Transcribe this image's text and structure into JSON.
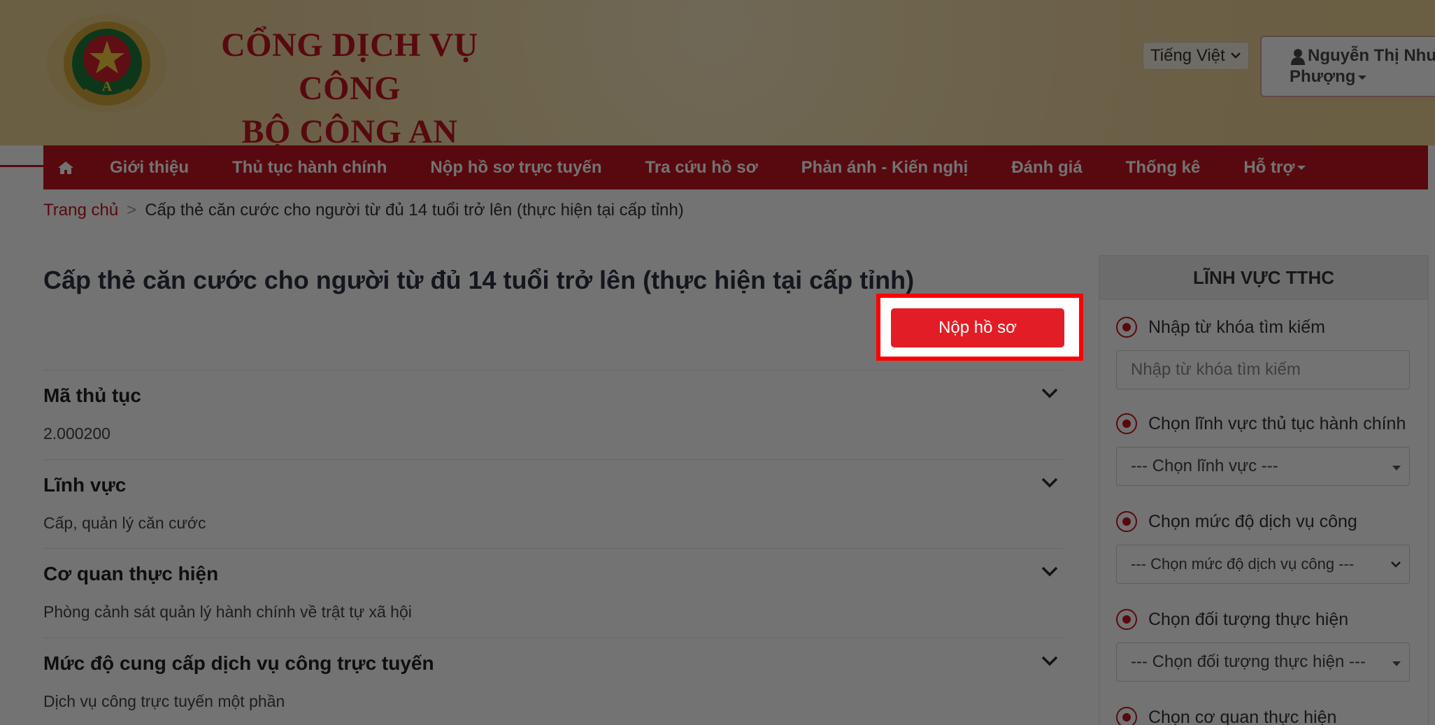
{
  "header": {
    "title_line1": "CỔNG DỊCH VỤ CÔNG",
    "title_line2": "BỘ CÔNG AN",
    "language": "Tiếng Việt",
    "user_name_line1": "Nguyễn Thị Như",
    "user_name_line2": "Phượng"
  },
  "nav": {
    "items": [
      {
        "label": "Giới thiệu"
      },
      {
        "label": "Thủ tục hành chính"
      },
      {
        "label": "Nộp hồ sơ trực tuyến"
      },
      {
        "label": "Tra cứu hồ sơ"
      },
      {
        "label": "Phản ánh - Kiến nghị"
      },
      {
        "label": "Đánh giá"
      },
      {
        "label": "Thống kê"
      },
      {
        "label": "Hỗ trợ"
      }
    ]
  },
  "breadcrumb": {
    "home": "Trang chủ",
    "separator": ">",
    "current": "Cấp thẻ căn cước cho người từ đủ 14 tuổi trở lên (thực hiện tại cấp tỉnh)"
  },
  "main": {
    "title": "Cấp thẻ căn cước cho người từ đủ 14 tuổi trở lên (thực hiện tại cấp tỉnh)",
    "submit_label": "Nộp hồ sơ",
    "sections": [
      {
        "title": "Mã thủ tục",
        "value": "2.000200"
      },
      {
        "title": "Lĩnh vực",
        "value": "Cấp, quản lý căn cước"
      },
      {
        "title": "Cơ quan thực hiện",
        "value": "Phòng cảnh sát quản lý hành chính về trật tự xã hội"
      },
      {
        "title": "Mức độ cung cấp dịch vụ công trực tuyến",
        "value": "Dịch vụ công trực tuyến một phần"
      }
    ]
  },
  "sidebar": {
    "heading": "LĨNH VỰC TTHC",
    "keyword_label": "Nhập từ khóa tìm kiếm",
    "keyword_placeholder": "Nhập từ khóa tìm kiếm",
    "field_label": "Chọn lĩnh vực thủ tục hành chính",
    "field_value": "--- Chọn lĩnh vực ---",
    "level_label": "Chọn mức độ dịch vụ công",
    "level_value": "--- Chọn mức độ dịch vụ công ---",
    "subject_label": "Chọn đối tượng thực hiện",
    "subject_value": "--- Chọn đối tượng thực hiện ---",
    "agency_label": "Chọn cơ quan thực hiện"
  },
  "colors": {
    "brand_red": "#c41622",
    "button_red": "#e31d25",
    "highlight": "#ff0000"
  }
}
